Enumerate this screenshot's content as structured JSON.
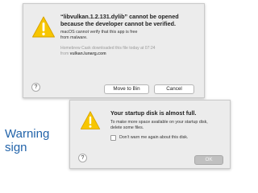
{
  "dialog1": {
    "icon": "warning-icon",
    "title": "“libvulkan.1.2.131.dylib” cannot be opened\nbecause the developer cannot be verified.",
    "message": "macOS cannot verify that this app is free\nfrom malware.",
    "source_line1": "Homebrew Cask downloaded this file today at 07:24",
    "source_from": "from",
    "source_host": "vulkan.lunarg.com",
    "help_label": "?",
    "move_to_bin_label": "Move to Bin",
    "cancel_label": "Cancel"
  },
  "dialog2": {
    "icon": "warning-icon",
    "title": "Your startup disk is almost full.",
    "message": "To make more space available on your startup disk,\ndelete some files.",
    "checkbox_label": "Don’t warn me again about this disk.",
    "checkbox_checked": false,
    "help_label": "?",
    "ok_label": "OK"
  },
  "caption": "Warning\nsign",
  "colors": {
    "caption": "#2364aa",
    "warning_yellow": "#f7c600"
  }
}
